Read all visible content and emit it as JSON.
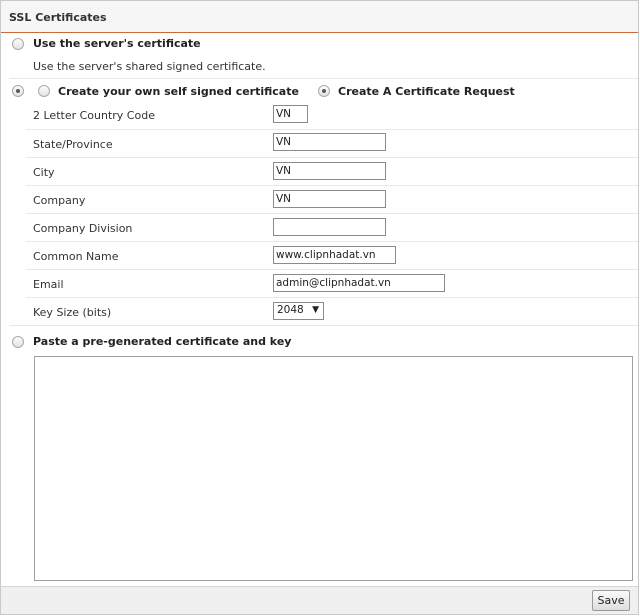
{
  "panel": {
    "title": "SSL Certificates"
  },
  "options": {
    "server_cert": {
      "label": "Use the server's certificate",
      "description": "Use the server's shared signed certificate.",
      "selected": false
    },
    "self_signed": {
      "label": "Create your own self signed certificate",
      "selected": false
    },
    "cert_request": {
      "label": "Create A Certificate Request",
      "selected": true
    },
    "pregenerated": {
      "label": "Paste a pre-generated certificate and key",
      "selected": false
    }
  },
  "form": {
    "country": {
      "label": "2 Letter Country Code",
      "value": "VN"
    },
    "state": {
      "label": "State/Province",
      "value": "VN"
    },
    "city": {
      "label": "City",
      "value": "VN"
    },
    "company": {
      "label": "Company",
      "value": "VN"
    },
    "division": {
      "label": "Company Division",
      "value": ""
    },
    "common_name": {
      "label": "Common Name",
      "value": "www.clipnhadat.vn"
    },
    "email": {
      "label": "Email",
      "value": "admin@clipnhadat.vn"
    },
    "key_size": {
      "label": "Key Size (bits)",
      "value": "2048",
      "arrow": "▼"
    }
  },
  "pregenerated_text": "",
  "footer": {
    "save_label": "Save"
  }
}
